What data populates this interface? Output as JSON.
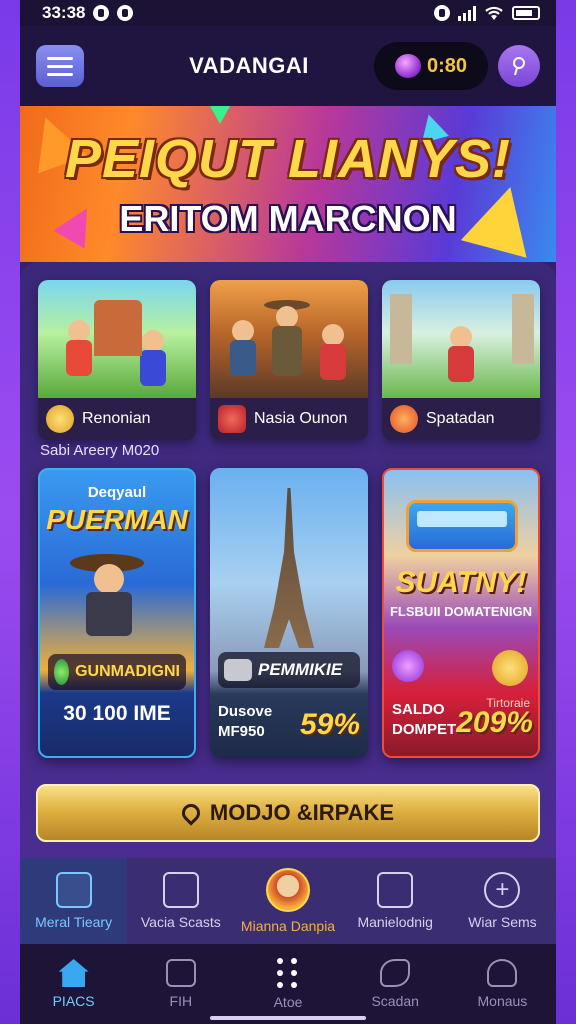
{
  "status_bar": {
    "time": "33:38"
  },
  "header": {
    "title": "VADANGAI",
    "coin_value": "0:80"
  },
  "hero": {
    "title": "PEIQUT LIANYS!",
    "subtitle": "ERITOM MARCNON"
  },
  "games_small": [
    {
      "name": "Renonian"
    },
    {
      "name": "Nasia Ounon"
    },
    {
      "name": "Spatadan"
    }
  ],
  "section_label": "Sabi Areery M020",
  "games_large": [
    {
      "top_small": "Deqyaul",
      "title": "PUERMAN",
      "tag": "GUNMADIGNI",
      "bottom_text": "30 100 IME"
    },
    {
      "tag": "PEMMIKIE",
      "label_line1": "Dusove",
      "label_line2": "MF950",
      "percent": "59%"
    },
    {
      "title": "SUATNY!",
      "subtitle": "FLSBUII DOMATENIGN",
      "corner_text": "Tirtoraie",
      "label_line1": "SALDO",
      "label_line2": "DOMPET",
      "percent": "209%"
    }
  ],
  "cta": {
    "label": "MODJO &IRPAKE"
  },
  "categories": [
    {
      "label": "Meral Tieary",
      "icon": "envelope-icon"
    },
    {
      "label": "Vacia Scasts",
      "icon": "ledger-icon"
    },
    {
      "label": "Mianna Danpia",
      "icon": "featured-badge-icon"
    },
    {
      "label": "Manielodnig",
      "icon": "door-icon"
    },
    {
      "label": "Wiar Sems",
      "icon": "plus-icon"
    }
  ],
  "bottom_nav": [
    {
      "label": "PIACS",
      "icon": "home-icon"
    },
    {
      "label": "FIH",
      "icon": "hat-icon"
    },
    {
      "label": "Atoe",
      "icon": "grid-icon"
    },
    {
      "label": "Scadan",
      "icon": "feather-icon"
    },
    {
      "label": "Monaus",
      "icon": "person-icon"
    }
  ],
  "colors": {
    "accent": "#7ac8ff",
    "gold": "#ffd84a",
    "background": "#3a2378",
    "brand_purple": "#6b2fd6"
  }
}
